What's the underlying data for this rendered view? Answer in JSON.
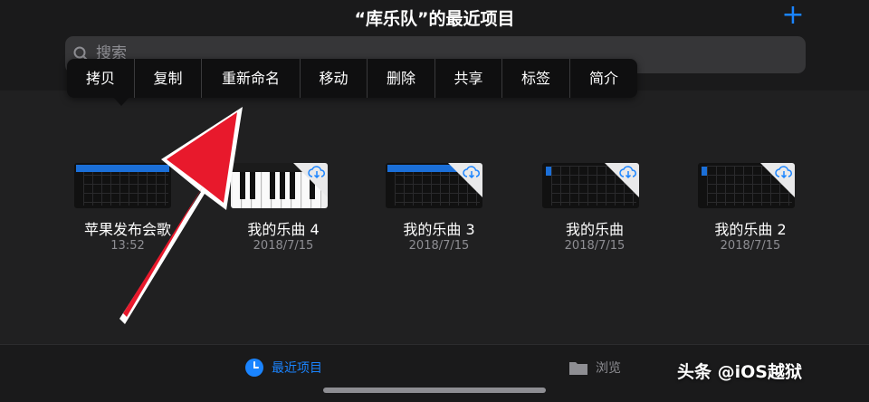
{
  "header": {
    "title": "“库乐队”的最近项目",
    "add_icon": "plus-icon"
  },
  "search": {
    "placeholder": "搜索",
    "icon": "search-icon"
  },
  "context_menu": {
    "items": [
      "拷贝",
      "复制",
      "重新命名",
      "移动",
      "删除",
      "共享",
      "标签",
      "简介"
    ]
  },
  "projects": [
    {
      "name": "苹果发布会歌",
      "meta": "13:52",
      "thumb": "tracks"
    },
    {
      "name": "我的乐曲 4",
      "meta": "2018/7/15",
      "thumb": "keyboard"
    },
    {
      "name": "我的乐曲 3",
      "meta": "2018/7/15",
      "thumb": "tracks"
    },
    {
      "name": "我的乐曲",
      "meta": "2018/7/15",
      "thumb": "grid"
    },
    {
      "name": "我的乐曲 2",
      "meta": "2018/7/15",
      "thumb": "grid"
    }
  ],
  "tabbar": {
    "recent_label": "最近项目",
    "browse_label": "浏览",
    "recent_icon": "clock-icon",
    "browse_icon": "folder-icon"
  },
  "watermark": "头条 @iOS越狱",
  "colors": {
    "accent": "#1a84ff",
    "annotation_arrow": "#e8192c",
    "background": "#1e1e1f"
  }
}
